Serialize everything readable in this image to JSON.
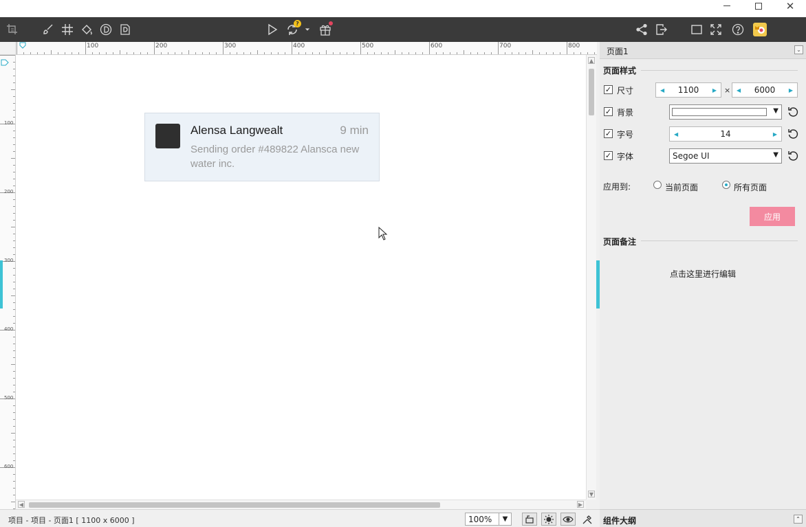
{
  "window": {
    "minimize": "minimize",
    "maximize": "maximize",
    "close": "close"
  },
  "toolbar": {
    "left_icons": [
      "crop-icon",
      "brush-icon",
      "grid-icon",
      "fill-icon",
      "d-circle-icon",
      "d-page-icon"
    ],
    "center_icons": [
      "play-icon",
      "sync-icon",
      "gift-icon"
    ],
    "right_icons": [
      "share-icon",
      "export-icon",
      "frame-icon",
      "fullscreen-icon",
      "help-icon",
      "avatar-icon"
    ],
    "sync_badge": "?"
  },
  "ruler": {
    "h_labels": [
      "100",
      "200",
      "300",
      "400",
      "500",
      "600",
      "700",
      "800"
    ],
    "v_labels": [
      "100",
      "200",
      "300",
      "400",
      "500",
      "600"
    ]
  },
  "card": {
    "name": "Alensa Langwealt",
    "time": "9 min",
    "message": "Sending order #489822 Alansca new water inc."
  },
  "panel": {
    "title": "页面1",
    "page_style_title": "页面样式",
    "size_label": "尺寸",
    "size_width": "1100",
    "size_times": "×",
    "size_height": "6000",
    "background_label": "背景",
    "font_size_label": "字号",
    "font_size_value": "14",
    "font_label": "字体",
    "font_value": "Segoe UI",
    "apply_to_label": "应用到:",
    "apply_current": "当前页面",
    "apply_all": "所有页面",
    "apply_selected": "所有页面",
    "apply_button": "应用",
    "notes_title": "页面备注",
    "notes_placeholder": "点击这里进行编辑",
    "accent_color": "#27a9c5",
    "apply_button_color": "#f38aa0"
  },
  "statusbar": {
    "path": "项目 - 项目 - 页面1 [ 1100 x 6000 ]",
    "zoom": "100%",
    "icons": [
      "fit-icon",
      "sun-icon",
      "eye-icon",
      "tools-icon"
    ]
  },
  "outline": {
    "title": "组件大纲"
  }
}
